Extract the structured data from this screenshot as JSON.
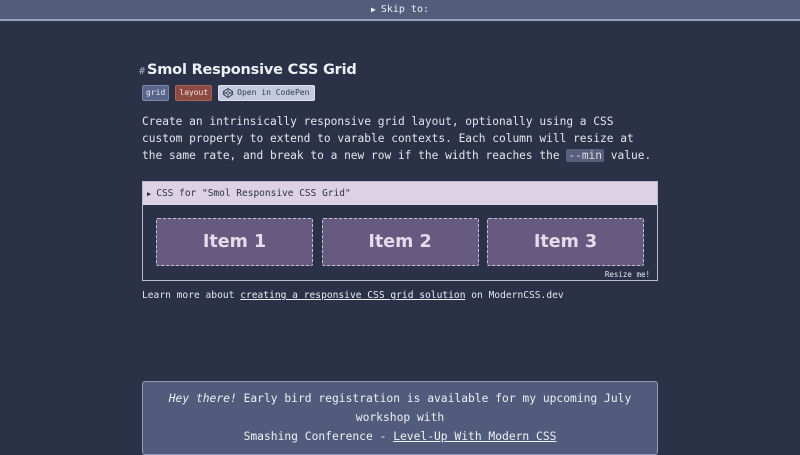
{
  "skip": {
    "label": "Skip to:",
    "glyph": "▶"
  },
  "section": {
    "anchor": "#",
    "title": "Smol Responsive CSS Grid",
    "tags": {
      "grid": "grid",
      "layout": "layout",
      "codepen": "Open in CodePen"
    },
    "description": {
      "part1": "Create an intrinsically responsive grid layout, optionally using a CSS custom property to extend to varable contexts. Each column will resize at the same rate, and break to a new row if the width reaches the ",
      "code": "--min",
      "part2": " value."
    }
  },
  "demo": {
    "summary_glyph": "▶",
    "summary": "CSS for \"Smol Responsive CSS Grid\"",
    "items": [
      "Item 1",
      "Item 2",
      "Item 3"
    ],
    "resize": "Resize me!"
  },
  "learn": {
    "prefix": "Learn more about ",
    "link": "creating a responsive CSS grid solution",
    "suffix": " on ModernCSS.dev"
  },
  "banner": {
    "greeting": "Hey there!",
    "text1": " Early bird registration is available for my upcoming July workshop with",
    "text2": "Smashing Conference - ",
    "link": "Level-Up With Modern CSS"
  },
  "colors": {
    "background": "#2b3147",
    "skipbar": "#525d7c",
    "item": "#675a80",
    "summary": "#ddd2e3",
    "banner": "#515c7c"
  },
  "icons": {
    "codepen": "codepen-icon"
  }
}
